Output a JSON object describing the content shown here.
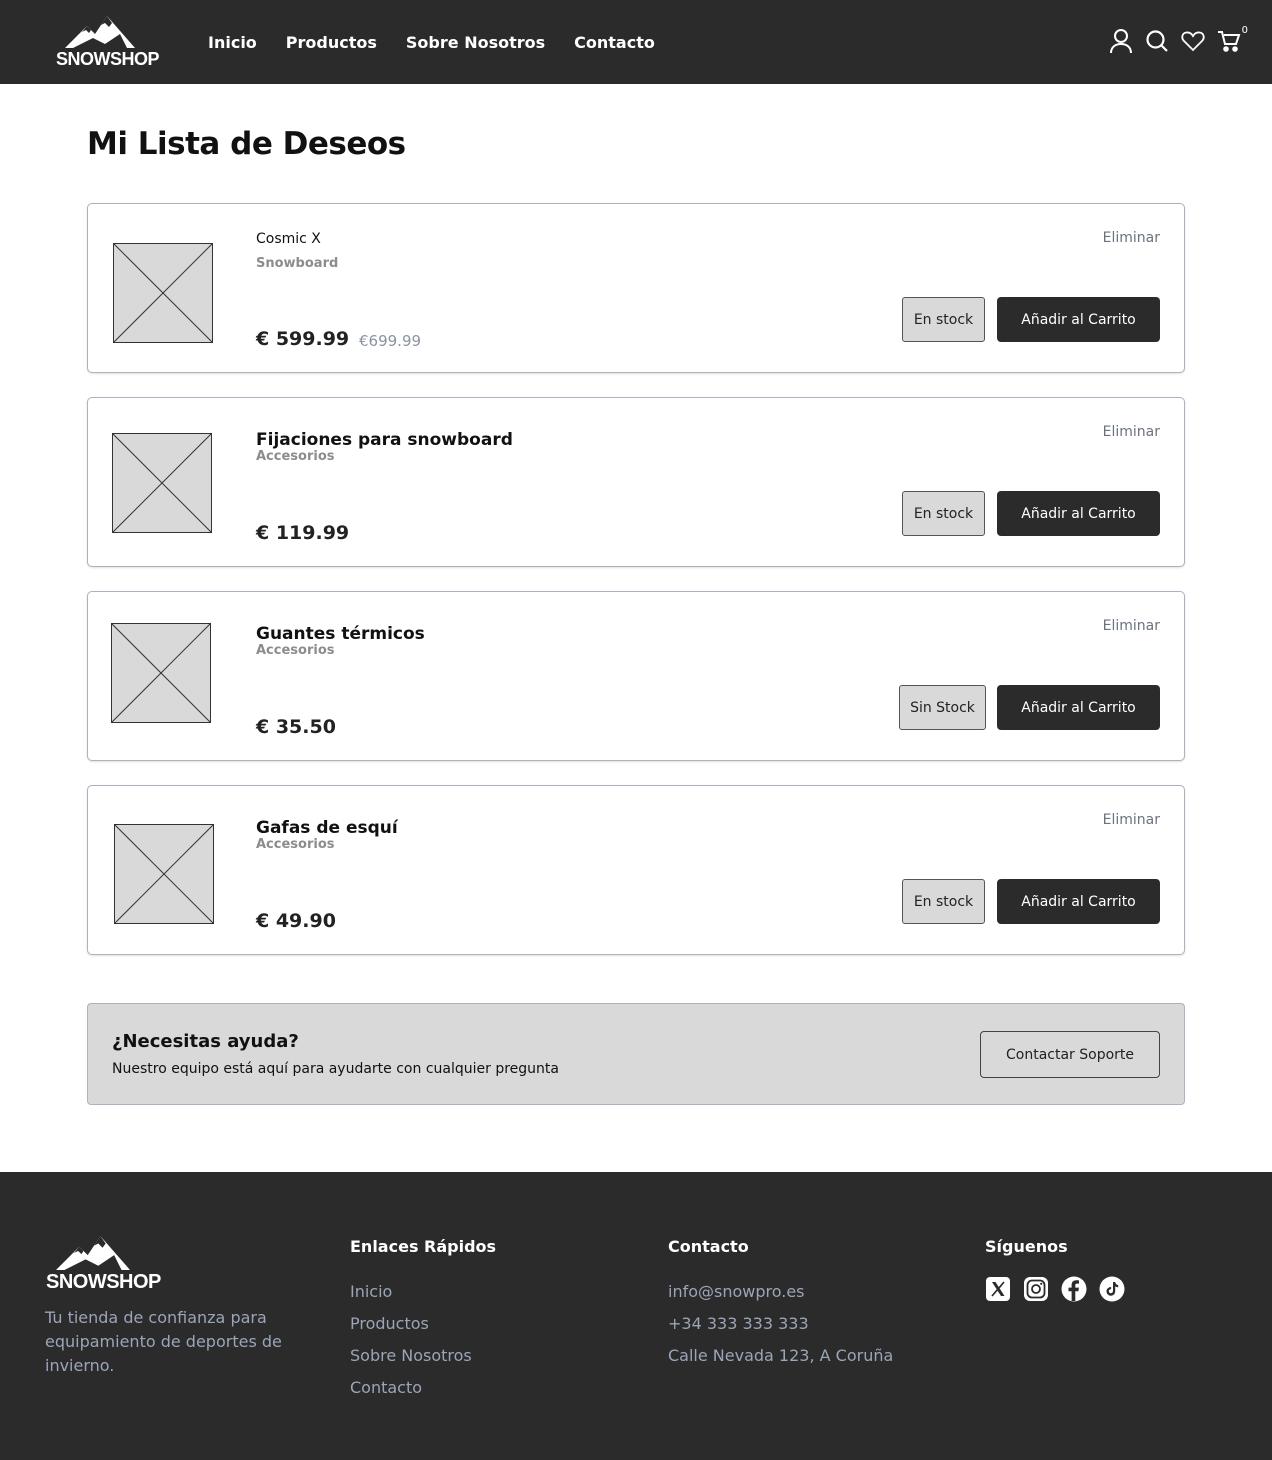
{
  "brand": {
    "name": "SNOWSHOP"
  },
  "nav": [
    "Inicio",
    "Productos",
    "Sobre Nosotros",
    "Contacto"
  ],
  "header_icons": {
    "user": "user-icon",
    "search": "search-icon",
    "wishlist": "heart-icon",
    "cart": "cart-icon",
    "cart_count": "0"
  },
  "page": {
    "title": "Mi Lista de Deseos"
  },
  "wishlist": [
    {
      "name": "Cosmic X",
      "category": "Snowboard",
      "price": "€ 599.99",
      "old_price": "€699.99",
      "stock": "En stock",
      "add_label": "Añadir al Carrito",
      "remove_label": "Eliminar"
    },
    {
      "name": "Fijaciones para snowboard",
      "category": "Accesorios",
      "price": "€ 119.99",
      "stock": "En stock",
      "add_label": "Añadir al Carrito",
      "remove_label": "Eliminar"
    },
    {
      "name": "Guantes térmicos",
      "category": "Accesorios",
      "price": "€ 35.50",
      "stock": "Sin Stock",
      "add_label": "Añadir al Carrito",
      "remove_label": "Eliminar"
    },
    {
      "name": "Gafas de esquí",
      "category": "Accesorios",
      "price": "€ 49.90",
      "stock": "En stock",
      "add_label": "Añadir al Carrito",
      "remove_label": "Eliminar"
    }
  ],
  "help": {
    "title": "¿Necesitas ayuda?",
    "text": "Nuestro equipo está aquí para ayudarte con cualquier pregunta",
    "button": "Contactar Soporte"
  },
  "footer": {
    "tagline": "Tu tienda de confianza para equipamiento de deportes de invierno.",
    "quick_links": {
      "title": "Enlaces Rápidos",
      "items": [
        "Inicio",
        "Productos",
        "Sobre Nosotros",
        "Contacto"
      ]
    },
    "contact": {
      "title": "Contacto",
      "email": "info@snowpro.es",
      "phone": "+34 333 333 333",
      "address": "Calle Nevada 123, A Coruña"
    },
    "social": {
      "title": "Síguenos",
      "icons": [
        "x-icon",
        "instagram-icon",
        "facebook-icon",
        "tiktok-icon"
      ]
    }
  },
  "colors": {
    "dark": "#2b2b2b",
    "muted": "#9aa5b8",
    "placeholder": "#d9d9d9",
    "border": "#aab3c0"
  }
}
